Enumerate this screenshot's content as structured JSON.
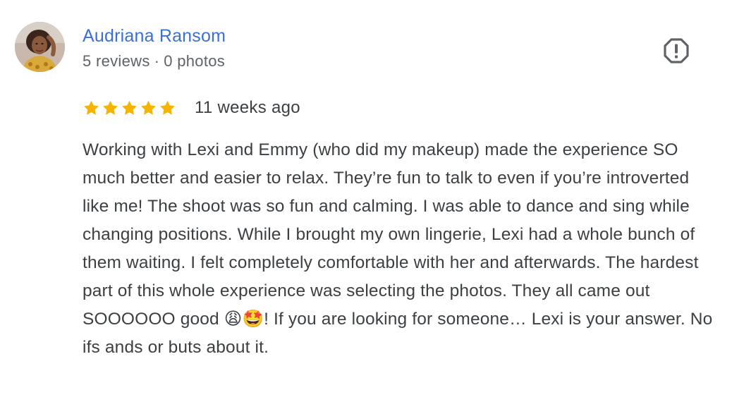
{
  "review": {
    "author": {
      "name": "Audriana Ransom",
      "reviews_count": "5 reviews",
      "separator": "·",
      "photos_count": "0 photos",
      "avatar_icon": "user-avatar-photo"
    },
    "report_icon": "report-flag-icon",
    "rating": {
      "stars": 5,
      "max_stars": 5,
      "star_color": "#f4b400"
    },
    "date": "11 weeks ago",
    "text": "Working with Lexi and Emmy (who did my makeup) made the experience SO much better and easier to relax. They’re fun to talk to even if you’re introverted like me! The shoot was so fun and calming. I was able to dance and sing while changing positions. While I brought my own lingerie, Lexi had a whole bunch of them waiting. I felt completely comfortable with her and afterwards. The hardest part of this whole experience was selecting the photos. They all came out SOOOOOO good 😩🤩! If you are looking for someone… Lexi is your answer. No ifs ands or buts about it."
  },
  "colors": {
    "author_link": "#3b6fd8",
    "meta_text": "#5f6368",
    "body_text": "#3c4043",
    "star": "#f4b400"
  }
}
